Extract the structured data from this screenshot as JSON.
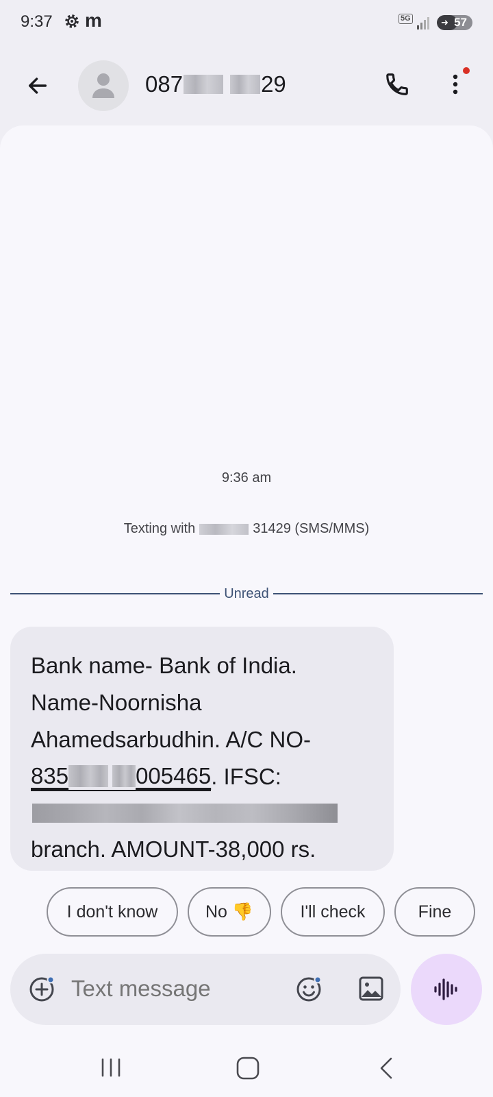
{
  "status_bar": {
    "time": "9:37",
    "app_icon_letter": "m",
    "network": "5G",
    "battery": "57",
    "battery_level": 0.57,
    "icons": [
      "settings-gear-icon",
      "m-app-icon",
      "network-5g-icon",
      "signal-icon",
      "battery-icon"
    ]
  },
  "header": {
    "contact_prefix": "087",
    "contact_suffix": "29",
    "icons": [
      "back-arrow-icon",
      "person-icon",
      "phone-icon",
      "more-vert-icon"
    ],
    "notification_dot_color": "#D93025"
  },
  "conversation": {
    "timestamp": "9:36 am",
    "texting_with_prefix": "Texting with",
    "texting_with_suffix": "31429 (SMS/MMS)",
    "unread_label": "Unread",
    "unread_color": "#3d5275",
    "message": {
      "line1": "Bank name- Bank of India.",
      "line2": "Name-Noornisha",
      "line3": "Ahamedsarbudhin. A/C NO-",
      "account_prefix": "835",
      "account_suffix": "005465",
      "line4_tail": ". IFSC:",
      "line6": "branch. AMOUNT-38,000 rs."
    }
  },
  "smart_replies": [
    {
      "label": "I don't know"
    },
    {
      "label": "No 👎"
    },
    {
      "label": "I'll check"
    },
    {
      "label": "Fine"
    }
  ],
  "compose": {
    "placeholder": "Text message",
    "icons": [
      "add-circle-icon",
      "emoji-icon",
      "gallery-icon",
      "voice-waveform-icon"
    ],
    "voice_button_color": "#EBD9FB"
  },
  "nav_bar": {
    "icons": [
      "recent-apps-icon",
      "home-icon",
      "back-icon"
    ]
  }
}
